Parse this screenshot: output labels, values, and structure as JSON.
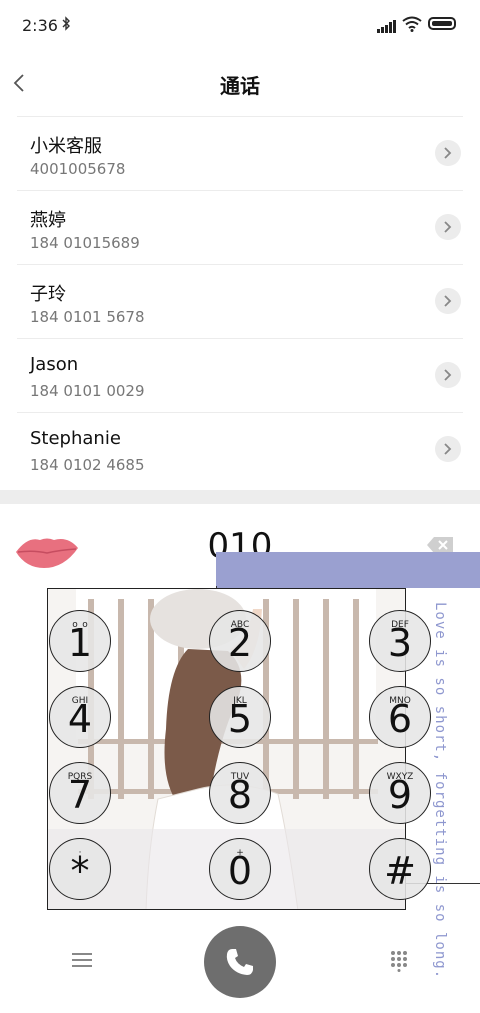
{
  "status": {
    "time": "2:36"
  },
  "header": {
    "title": "通话"
  },
  "contacts": [
    {
      "name": "小米客服",
      "number": "4001005678"
    },
    {
      "name": "燕婷",
      "number": "184 01015689"
    },
    {
      "name": "子玲",
      "number": "184 0101 5678"
    },
    {
      "name": "Jason",
      "number": "184 0101 0029"
    },
    {
      "name": "Stephanie",
      "number": "184 0102 4685"
    }
  ],
  "dialer": {
    "input": "010",
    "caption": "Love is so short, forgetting is so long.",
    "keys": [
      {
        "digit": "1",
        "letters": "o_o"
      },
      {
        "digit": "2",
        "letters": "ABC"
      },
      {
        "digit": "3",
        "letters": "DEF"
      },
      {
        "digit": "4",
        "letters": "GHI"
      },
      {
        "digit": "5",
        "letters": "JKL"
      },
      {
        "digit": "6",
        "letters": "MNO"
      },
      {
        "digit": "7",
        "letters": "PQRS"
      },
      {
        "digit": "8",
        "letters": "TUV"
      },
      {
        "digit": "9",
        "letters": "WXYZ"
      },
      {
        "digit": "*",
        "letters": "·"
      },
      {
        "digit": "0",
        "letters": "+"
      },
      {
        "digit": "#",
        "letters": ""
      }
    ]
  },
  "colors": {
    "accent_blue": "#9aa0d0",
    "lips": "#e8707f",
    "call_button": "#6e6e6e"
  },
  "icons": [
    "bluetooth-icon",
    "signal-icon",
    "wifi-icon",
    "battery-icon",
    "back-icon",
    "chevron-right-icon",
    "lips-icon",
    "backspace-icon",
    "menu-icon",
    "phone-icon",
    "keypad-icon"
  ]
}
